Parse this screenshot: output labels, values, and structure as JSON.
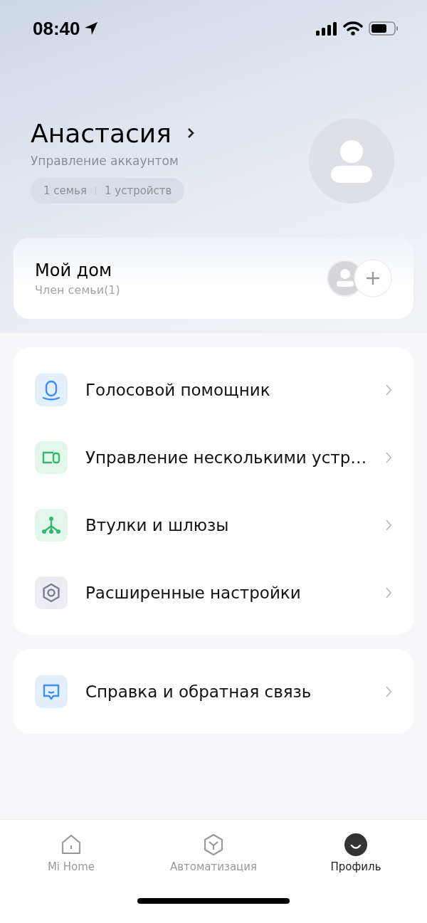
{
  "status_bar": {
    "time": "08:40"
  },
  "profile": {
    "name": "Анастасия",
    "subtitle": "Управление аккаунтом",
    "stats": [
      "1 семья",
      "1 устройств"
    ]
  },
  "home_card": {
    "title": "Мой дом",
    "subtitle": "Член семьи(1)"
  },
  "menu_groups": [
    {
      "items": [
        {
          "kind": "voice",
          "label": "Голосовой помощник"
        },
        {
          "kind": "devices",
          "label": "Управление несколькими устр…"
        },
        {
          "kind": "hub",
          "label": "Втулки и шлюзы"
        },
        {
          "kind": "settings",
          "label": "Расширенные настройки"
        }
      ]
    },
    {
      "items": [
        {
          "kind": "help",
          "label": "Справка и обратная связь"
        }
      ]
    }
  ],
  "tabs": [
    {
      "kind": "home",
      "label": "Mi Home",
      "selected": false
    },
    {
      "kind": "automation",
      "label": "Автоматизация",
      "selected": false
    },
    {
      "kind": "profile",
      "label": "Профиль",
      "selected": true
    }
  ]
}
